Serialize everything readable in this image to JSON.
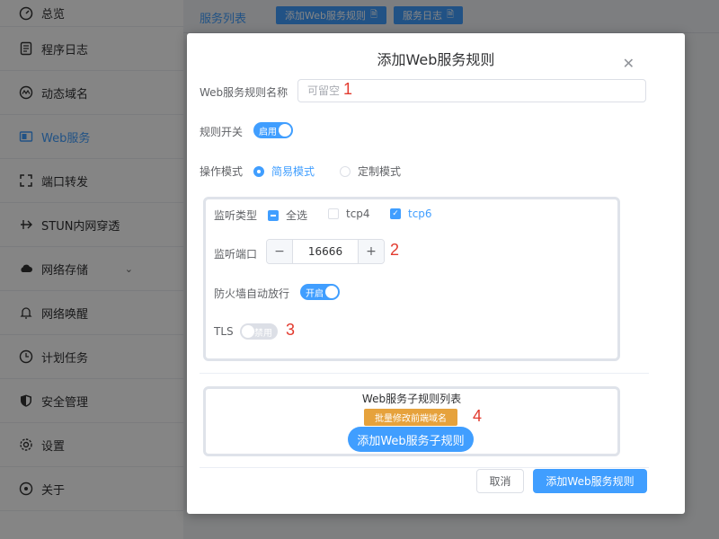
{
  "sidebar": {
    "items": [
      {
        "label": "总览",
        "icon": "dashboard-icon"
      },
      {
        "label": "程序日志",
        "icon": "log-icon"
      },
      {
        "label": "动态域名",
        "icon": "ddns-icon"
      },
      {
        "label": "Web服务",
        "icon": "web-service-icon",
        "active": true
      },
      {
        "label": "端口转发",
        "icon": "port-forward-icon"
      },
      {
        "label": "STUN内网穿透",
        "icon": "stun-icon"
      },
      {
        "label": "网络存储",
        "icon": "cloud-storage-icon"
      },
      {
        "label": "网络唤醒",
        "icon": "bell-icon"
      },
      {
        "label": "计划任务",
        "icon": "clock-icon"
      },
      {
        "label": "安全管理",
        "icon": "shield-icon"
      },
      {
        "label": "设置",
        "icon": "gear-icon"
      },
      {
        "label": "关于",
        "icon": "about-icon"
      }
    ]
  },
  "topbar": {
    "active_tab": "服务列表",
    "add_rule_btn": "添加Web服务规则",
    "service_log_btn": "服务日志"
  },
  "dialog": {
    "title": "添加Web服务规则",
    "name_label": "Web服务规则名称",
    "name_value": "",
    "name_placeholder": "可留空",
    "switch_label": "规则开关",
    "switch_text": "启用",
    "mode_label": "操作模式",
    "mode_simple": "简易模式",
    "mode_custom": "定制模式",
    "listen_type_label": "监听类型",
    "cb_all": "全选",
    "cb_tcp4": "tcp4",
    "cb_tcp6": "tcp6",
    "listen_port_label": "监听端口",
    "port_value": "16666",
    "port_minus": "−",
    "port_plus": "+",
    "firewall_label": "防火墙自动放行",
    "firewall_text": "开启",
    "tls_label": "TLS",
    "tls_text": "禁用",
    "sub_rules_title": "Web服务子规则列表",
    "batch_btn": "批量修改前端域名",
    "add_sub_btn": "添加Web服务子规则",
    "cancel_btn": "取消",
    "submit_btn": "添加Web服务规则",
    "annotations": [
      "1",
      "2",
      "3",
      "4"
    ]
  },
  "colors": {
    "primary": "#409eff",
    "warning": "#e6a23c",
    "annotation": "#e23a2e"
  }
}
